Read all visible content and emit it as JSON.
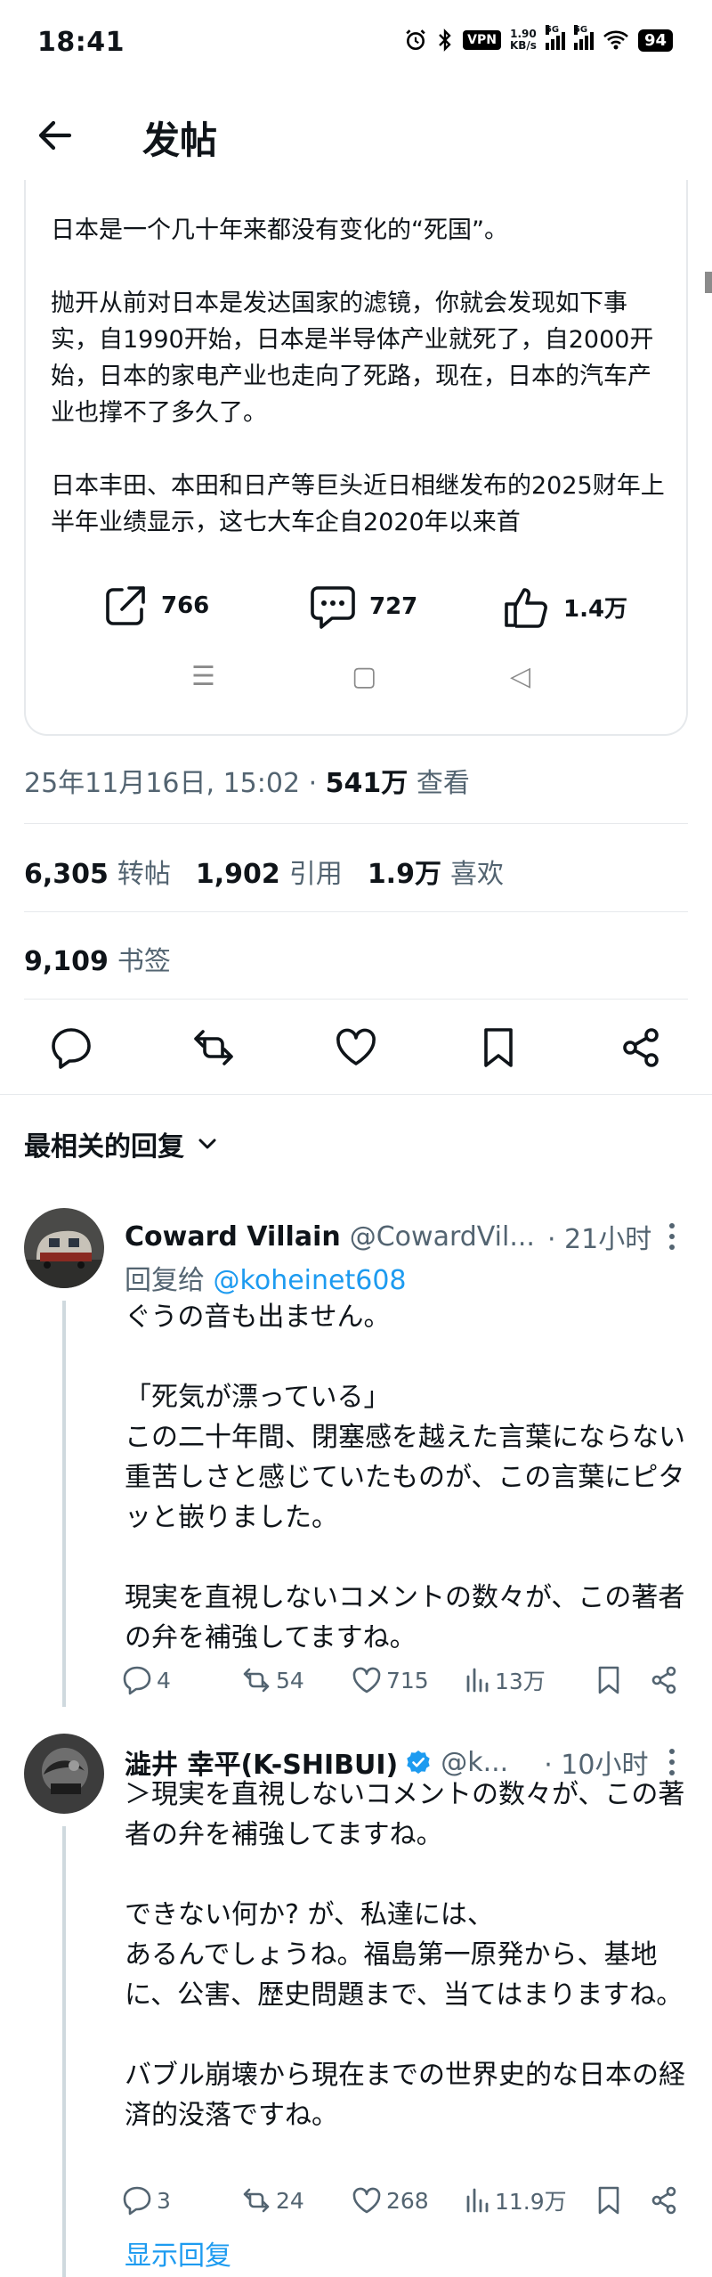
{
  "status_bar": {
    "time": "18:41",
    "vpn": "VPN",
    "speed_value": "1.90",
    "speed_unit": "KB/s",
    "network_1": "5G",
    "network_2": "5G",
    "battery": "94",
    "icons": [
      "alarm-icon",
      "bluetooth-icon",
      "wifi-icon"
    ]
  },
  "header": {
    "title": "发帖"
  },
  "quoted_post": {
    "paragraphs": [
      "日本是一个几十年来都没有变化的“死国”。",
      "抛开从前对日本是发达国家的滤镜，你就会发现如下事实，自1990开始，日本是半导体产业就死了，自2000开始，日本的家电产业也走向了死路，现在，日本的汽车产业也撑不了多久了。",
      "日本丰田、本田和日产等巨头近日相继发布的2025财年上半年业绩显示，这七大车企自2020年以来首"
    ],
    "retweets": "766",
    "replies": "727",
    "likes": "1.4万",
    "nav": [
      "☰",
      "▢",
      "◁"
    ]
  },
  "post_meta": {
    "datetime": "25年11月16日, 15:02 · ",
    "views": "541万",
    "views_label": " 查看"
  },
  "post_stats": {
    "retweets_count": "6,305",
    "retweets_label": "转帖",
    "quotes_count": "1,902",
    "quotes_label": "引用",
    "likes_count": "1.9万",
    "likes_label": "喜欢",
    "bookmarks_count": "9,109",
    "bookmarks_label": "书签"
  },
  "sort": {
    "label": "最相关的回复"
  },
  "replies": [
    {
      "name": "Coward Villain",
      "handle": "@CowardVil...",
      "time": "· 21小时",
      "replying_prefix": "回复给 ",
      "replying_to": "@koheinet608",
      "paragraphs": [
        "ぐうの音も出ません。",
        "「死気が漂っている」\nこの二十年間、閉塞感を越えた言葉にならない重苦しさと感じていたものが、この言葉にピタッと嵌りました。",
        "現実を直視しないコメントの数々が、この著者の弁を補強してますね。"
      ],
      "reply_count": "4",
      "retweet_count": "54",
      "like_count": "715",
      "view_count": "13万"
    },
    {
      "name": "澁井 幸平(K-SHIBUI)",
      "handle": "@k...",
      "time": "· 10小时",
      "paragraphs": [
        "＞現実を直視しないコメントの数々が、この著者の弁を補強してますね。",
        "できない何か? が、私達には、\nあるんでしょうね。福島第一原発から、基地に、公害、歴史問題まで、当てはまりますね。",
        "バブル崩壊から現在までの世界史的な日本の経済的没落ですね。"
      ],
      "reply_count": "3",
      "retweet_count": "24",
      "like_count": "268",
      "view_count": "11.9万",
      "show_replies": "显示回复"
    }
  ],
  "colors": {
    "text": "#0f1419",
    "secondary": "#536471",
    "link": "#1d9bf0",
    "verified": "#1d9bf0",
    "divider": "#e6e9ec"
  }
}
